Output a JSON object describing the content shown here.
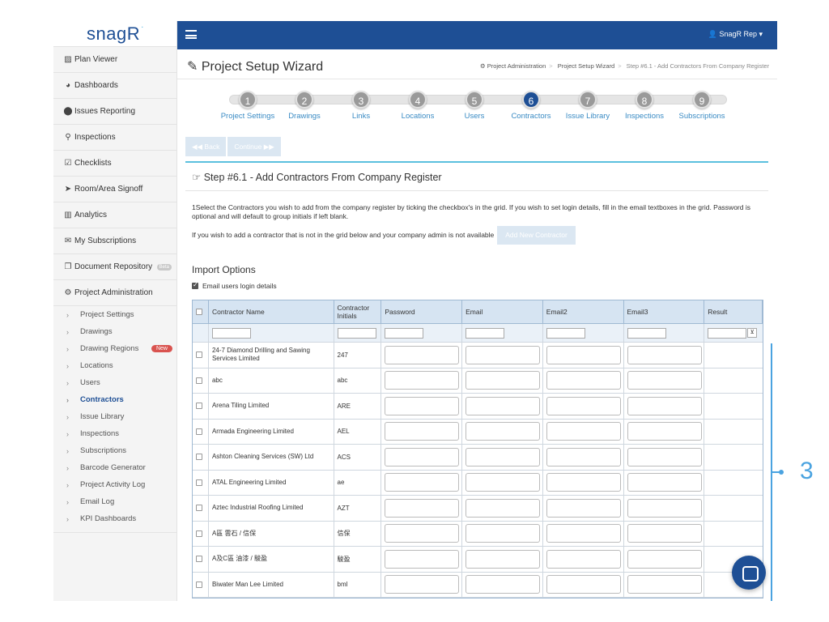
{
  "app": {
    "logo": "snagR",
    "logo_mark": "·"
  },
  "user": {
    "name": "SnagR Rep ▾"
  },
  "nav": [
    {
      "label": "Plan Viewer",
      "icon": "image-icon",
      "glyph": "▨"
    },
    {
      "label": "Dashboards",
      "icon": "dashboard-icon",
      "glyph": "◕"
    },
    {
      "label": "Issues Reporting",
      "icon": "map-marker-icon",
      "glyph": "⬤"
    },
    {
      "label": "Inspections",
      "icon": "search-icon",
      "glyph": "⚲"
    },
    {
      "label": "Checklists",
      "icon": "checkbox-icon",
      "glyph": "☑"
    },
    {
      "label": "Room/Area Signoff",
      "icon": "paper-plane-icon",
      "glyph": "➤"
    },
    {
      "label": "Analytics",
      "icon": "bar-chart-icon",
      "glyph": "▥"
    },
    {
      "label": "My Subscriptions",
      "icon": "envelope-icon",
      "glyph": "✉"
    },
    {
      "label": "Document Repository",
      "icon": "copy-icon",
      "glyph": "❐",
      "badge": "Beta"
    },
    {
      "label": "Project Administration",
      "icon": "cogs-icon",
      "glyph": "⚙"
    }
  ],
  "subnav": [
    {
      "label": "Project Settings"
    },
    {
      "label": "Drawings"
    },
    {
      "label": "Drawing Regions",
      "badge": "New"
    },
    {
      "label": "Locations"
    },
    {
      "label": "Users"
    },
    {
      "label": "Contractors",
      "active": true
    },
    {
      "label": "Issue Library"
    },
    {
      "label": "Inspections"
    },
    {
      "label": "Subscriptions"
    },
    {
      "label": "Barcode Generator"
    },
    {
      "label": "Project Activity Log"
    },
    {
      "label": "Email Log"
    },
    {
      "label": "KPI Dashboards"
    }
  ],
  "page": {
    "title": "Project Setup Wizard",
    "breadcrumb": [
      "Project Administration",
      "Project Setup Wizard",
      "Step #6.1 - Add Contractors From Company Register"
    ]
  },
  "wizard": {
    "steps": [
      {
        "num": "1",
        "label": "Project Settings"
      },
      {
        "num": "2",
        "label": "Drawings"
      },
      {
        "num": "3",
        "label": "Links"
      },
      {
        "num": "4",
        "label": "Locations"
      },
      {
        "num": "5",
        "label": "Users"
      },
      {
        "num": "6",
        "label": "Contractors",
        "active": true
      },
      {
        "num": "7",
        "label": "Issue Library"
      },
      {
        "num": "8",
        "label": "Inspections"
      },
      {
        "num": "9",
        "label": "Subscriptions"
      }
    ],
    "back_label": "◀◀ Back",
    "continue_label": "Continue ▶▶"
  },
  "panel": {
    "title": "Step #6.1 - Add Contractors From Company Register",
    "para1": "1Select the Contractors you wish to add from the company register by ticking the checkbox's in the grid. If you wish to set login details, fill in the email textboxes in the grid. Password is optional and will default to group initials if left blank.",
    "para2": "If you wish to add a contractor that is not in the grid below and your company admin is not available",
    "add_button": "Add New Contractor",
    "import_title": "Import Options",
    "email_login": "Email users login details"
  },
  "grid": {
    "headers": [
      "Contractor Name",
      "Contractor Initials",
      "Password",
      "Email",
      "Email2",
      "Email3",
      "Result"
    ],
    "rows": [
      {
        "name": "24-7 Diamond Drilling and Sawing Services Limited",
        "initials": "247"
      },
      {
        "name": "abc",
        "initials": "abc"
      },
      {
        "name": "Arena Tiling Limited",
        "initials": "ARE"
      },
      {
        "name": "Armada Engineering Limited",
        "initials": "AEL"
      },
      {
        "name": "Ashton Cleaning Services (SW) Ltd",
        "initials": "ACS"
      },
      {
        "name": "ATAL Engineering Limited",
        "initials": "ae"
      },
      {
        "name": "Aztec Industrial Roofing Limited",
        "initials": "AZT"
      },
      {
        "name": "A區 雲石 / 信保",
        "initials": "信保"
      },
      {
        "name": "A及C區 油漆 / 駿盈",
        "initials": "駿盈"
      },
      {
        "name": "Biwater Man Lee Limited",
        "initials": "bml"
      }
    ]
  },
  "annotation": {
    "number": "3"
  }
}
